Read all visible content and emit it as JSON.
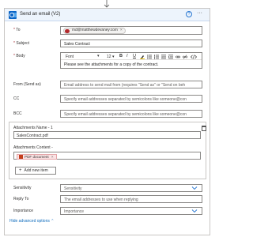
{
  "header": {
    "title": "Send an email (V2)",
    "help_glyph": "?",
    "more_glyph": "···"
  },
  "to": {
    "label": "To",
    "required_mark": "*",
    "recipient": "md@matthewdevaney.com",
    "remove_glyph": "×"
  },
  "subject": {
    "label": "Subject",
    "required_mark": "*",
    "value": "Sales Contract"
  },
  "body": {
    "label": "Body",
    "required_mark": "*",
    "font": "Font",
    "font_caret": "▾",
    "size": "12",
    "size_caret": "▾",
    "bold": "B",
    "italic": "I",
    "underline": "U",
    "value": "Please see the attachments for a copy of the contract."
  },
  "from": {
    "label": "From (Send as)",
    "placeholder": "Email address to send mail from (requires \"Send as\" or \"Send on beh"
  },
  "cc": {
    "label": "CC",
    "placeholder": "Specify email addresses separated by semicolons like someone@con"
  },
  "bcc": {
    "label": "BCC",
    "placeholder": "Specify email addresses separated by semicolons like someone@con"
  },
  "attachments": {
    "name_label": "Attachments Name - 1",
    "name_value": "SalesContract.pdf",
    "content_label": "Attachments Content -",
    "content_token": "PDF document",
    "token_remove": "×",
    "add_label": "Add new item",
    "add_glyph": "+"
  },
  "sensitivity": {
    "label": "Sensitivity",
    "placeholder": "Sensitivity"
  },
  "reply_to": {
    "label": "Reply To",
    "placeholder": "The email addresses to use when replying"
  },
  "importance": {
    "label": "Importance",
    "placeholder": "Importance"
  },
  "advanced": {
    "label": "Hide advanced options",
    "glyph": "⌃"
  },
  "colors": {
    "accent": "#0f6cbd",
    "header_bg": "#edf4fc",
    "required": "#a4262c",
    "avatar": "#b3292c",
    "pdf_token_bg": "#fbe3e4"
  }
}
